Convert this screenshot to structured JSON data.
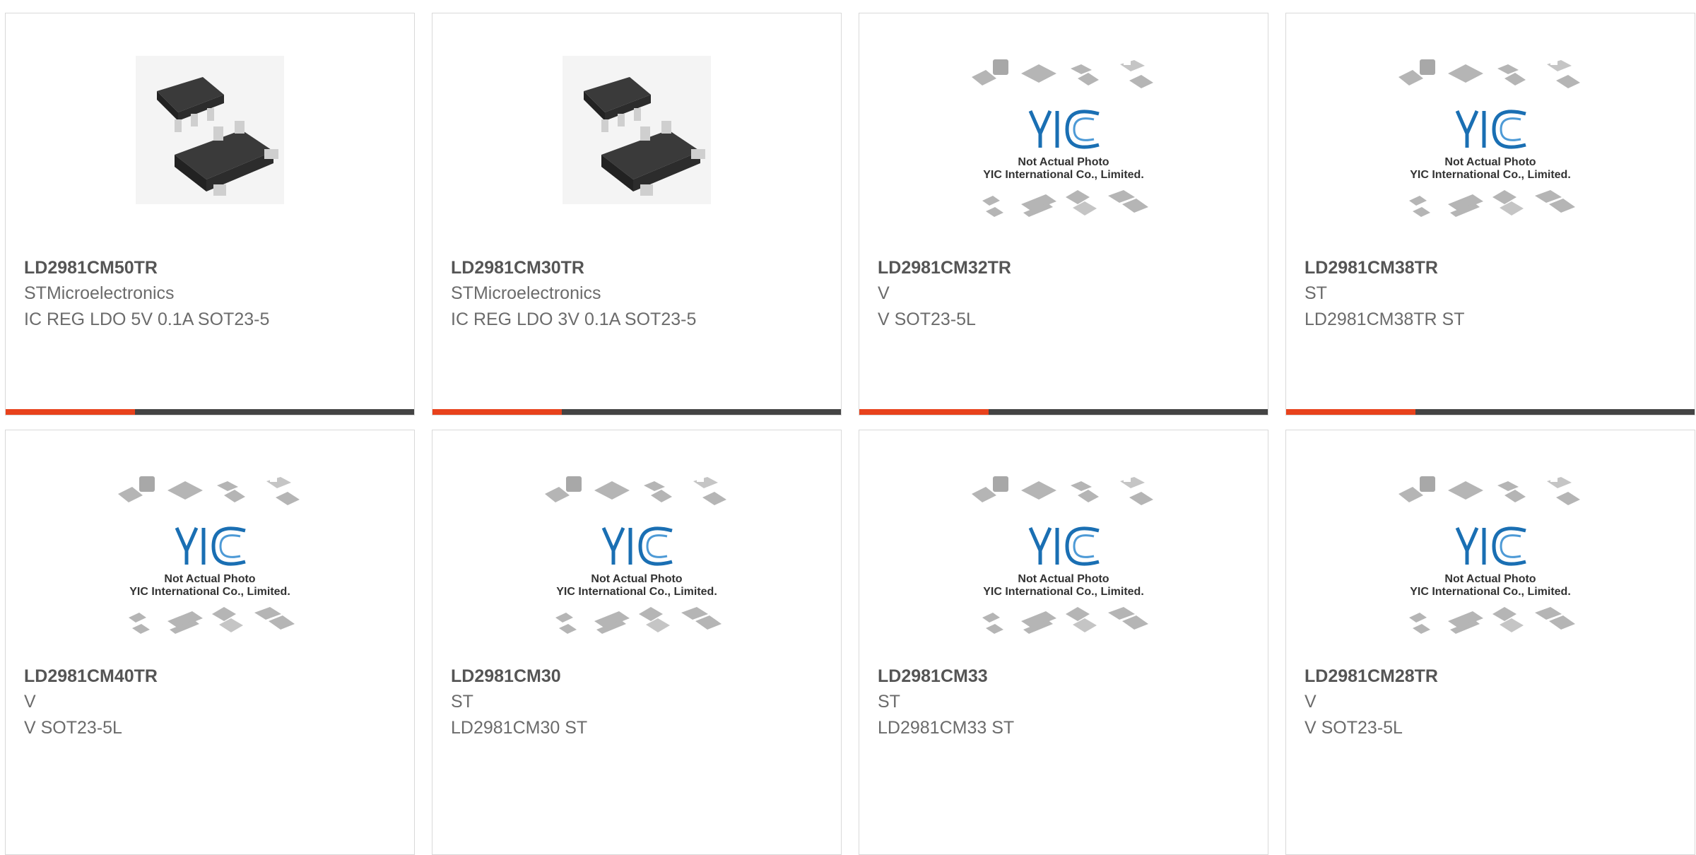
{
  "colors": {
    "accent": "#e8421c",
    "bar": "#444444",
    "part_number": "#555555",
    "text": "#6b6b6b",
    "logo_blue": "#1a6fb3"
  },
  "products": [
    {
      "part_number": "LD2981CM50TR",
      "manufacturer": "STMicroelectronics",
      "description": "IC REG LDO 5V 0.1A SOT23-5",
      "image": "sot23-5-package-photo"
    },
    {
      "part_number": "LD2981CM30TR",
      "manufacturer": "STMicroelectronics",
      "description": "IC REG LDO 3V 0.1A SOT23-5",
      "image": "sot23-5-package-photo"
    },
    {
      "part_number": "LD2981CM32TR",
      "manufacturer": "V",
      "description": "V SOT23-5L",
      "image": "placeholder-yic",
      "placeholder_line1": "Not Actual Photo",
      "placeholder_line2": "YIC International Co., Limited."
    },
    {
      "part_number": "LD2981CM38TR",
      "manufacturer": "ST",
      "description": "LD2981CM38TR ST",
      "image": "placeholder-yic",
      "placeholder_line1": "Not Actual Photo",
      "placeholder_line2": "YIC International Co., Limited."
    },
    {
      "part_number": "LD2981CM40TR",
      "manufacturer": "V",
      "description": "V SOT23-5L",
      "image": "placeholder-yic",
      "placeholder_line1": "Not Actual Photo",
      "placeholder_line2": "YIC International Co., Limited."
    },
    {
      "part_number": "LD2981CM30",
      "manufacturer": "ST",
      "description": "LD2981CM30 ST",
      "image": "placeholder-yic",
      "placeholder_line1": "Not Actual Photo",
      "placeholder_line2": "YIC International Co., Limited."
    },
    {
      "part_number": "LD2981CM33",
      "manufacturer": "ST",
      "description": "LD2981CM33 ST",
      "image": "placeholder-yic",
      "placeholder_line1": "Not Actual Photo",
      "placeholder_line2": "YIC International Co., Limited."
    },
    {
      "part_number": "LD2981CM28TR",
      "manufacturer": "V",
      "description": "V SOT23-5L",
      "image": "placeholder-yic",
      "placeholder_line1": "Not Actual Photo",
      "placeholder_line2": "YIC International Co., Limited."
    }
  ]
}
